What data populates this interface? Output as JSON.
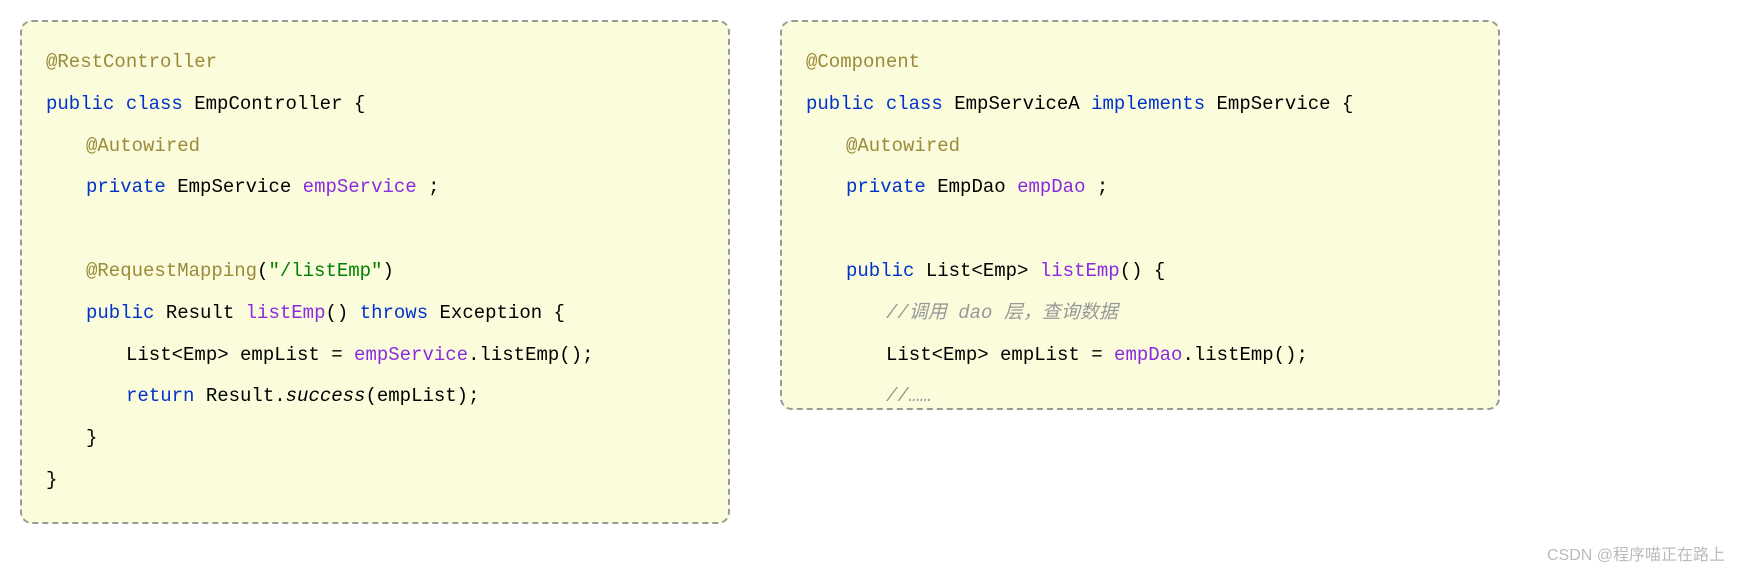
{
  "left": {
    "line1_anno": "@RestController",
    "line2_kw1": "public",
    "line2_kw2": "class",
    "line2_cls": "EmpController {",
    "line3_anno": "@Autowired",
    "line4_kw": "private",
    "line4_type": "EmpService",
    "line4_field": "empService",
    "line4_end": " ;",
    "line5_anno": "@RequestMapping",
    "line5_paren_open": "(",
    "line5_str": "\"/listEmp\"",
    "line5_paren_close": ")",
    "line6_kw": "public",
    "line6_type": "Result",
    "line6_method": "listEmp",
    "line6_parens": "()",
    "line6_throws": "throws",
    "line6_ex": "Exception {",
    "line7_text1": "List<Emp> empList = ",
    "line7_field": "empService",
    "line7_text2": ".listEmp();",
    "line8_kw": "return",
    "line8_text1": " Result.",
    "line8_method": "success",
    "line8_text2": "(empList);",
    "line9": "}",
    "line10": "}"
  },
  "right": {
    "line1_anno": "@Component",
    "line2_kw1": "public",
    "line2_kw2": "class",
    "line2_cls": "EmpServiceA",
    "line2_impl": "implements",
    "line2_iface": "EmpService {",
    "line3_anno": "@Autowired",
    "line4_kw": "private",
    "line4_type": "EmpDao",
    "line4_field": "empDao",
    "line4_end": " ;",
    "line5_kw": "public",
    "line5_type": "List<Emp>",
    "line5_method": "listEmp",
    "line5_end": "()  {",
    "line6_comment": "//调用 dao 层，查询数据",
    "line7_text1": "List<Emp> empList = ",
    "line7_field": "empDao",
    "line7_text2": ".listEmp();",
    "line8_comment": "//……"
  },
  "watermark": "CSDN @程序喵正在路上"
}
